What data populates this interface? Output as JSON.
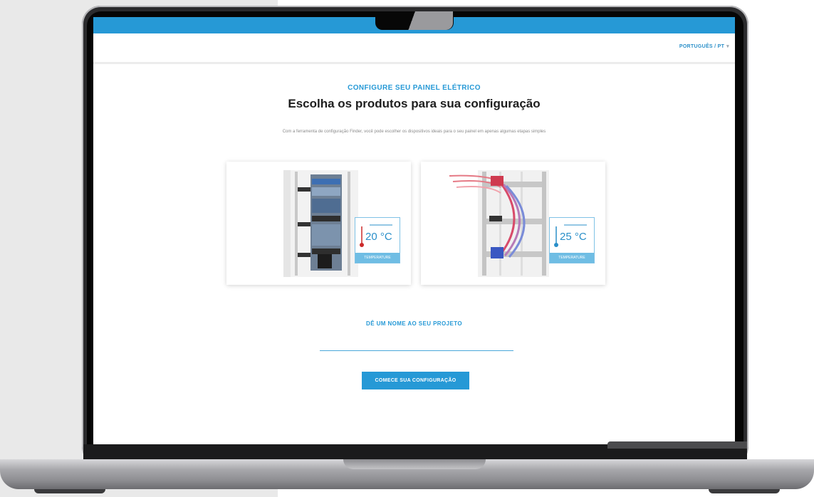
{
  "header": {
    "language_selector": "PORTUGUÊS / PT"
  },
  "hero": {
    "eyebrow": "CONFIGURE SEU PAINEL ELÉTRICO",
    "title": "Escolha os produtos para sua configuração",
    "description": "Com a ferramenta de configuração Finder, você pode escolher os dispositivos ideais para o seu painel em apenas algumas etapas simples"
  },
  "cards": [
    {
      "temperature_value": "20 °C",
      "temperature_label": "TEMPERATURE"
    },
    {
      "temperature_value": "25 °C",
      "temperature_label": "TEMPERATURE"
    }
  ],
  "project": {
    "label": "DÊ UM NOME AO SEU PROJETO",
    "input_value": ""
  },
  "start_button": "COMECE SUA CONFIGURAÇÃO",
  "colors": {
    "brand_blue": "#2699d6",
    "light_blue": "#6fbde4"
  }
}
